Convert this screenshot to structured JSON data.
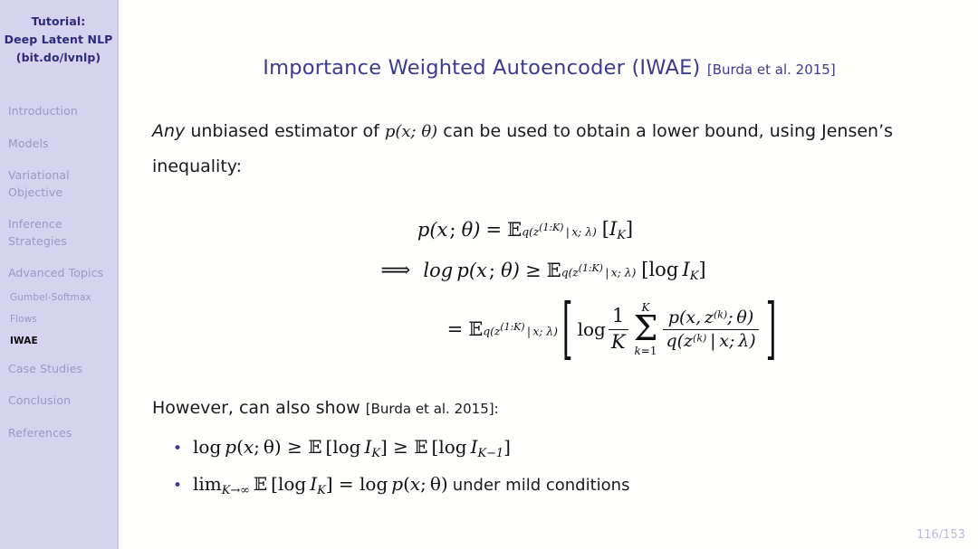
{
  "sidebar": {
    "title_lines": [
      "Tutorial:",
      "Deep Latent NLP",
      "(bit.do/lvnlp)"
    ],
    "items": [
      {
        "label": "Introduction",
        "level": 1,
        "active": false
      },
      {
        "label": "Models",
        "level": 1,
        "active": false
      },
      {
        "label": "Variational",
        "label2": "Objective",
        "level": 1,
        "active": false
      },
      {
        "label": "Inference",
        "label2": "Strategies",
        "level": 1,
        "active": false
      },
      {
        "label": "Advanced Topics",
        "level": 1,
        "active": false
      },
      {
        "label": "Gumbel-Softmax",
        "level": 2,
        "active": false
      },
      {
        "label": "Flows",
        "level": 2,
        "active": false
      },
      {
        "label": "IWAE",
        "level": 2,
        "active": true
      },
      {
        "label": "Case Studies",
        "level": 1,
        "active": false
      },
      {
        "label": "Conclusion",
        "level": 1,
        "active": false
      },
      {
        "label": "References",
        "level": 1,
        "active": false
      }
    ],
    "colors": {
      "background": "#d6d3f0",
      "title_text": "#2c2a7a",
      "item_text": "#9a98c4",
      "active_text": "#0b0b0b"
    }
  },
  "header": {
    "title": "Importance Weighted Autoencoder (IWAE)",
    "citation": "[Burda et al. 2015]",
    "color": "#3b3a8c"
  },
  "intro": {
    "emphasis": "Any",
    "part1": " unbiased estimator of ",
    "math": "p(x; θ)",
    "part2": " can be used to obtain a lower bound, using Jensen’s inequality:"
  },
  "equations": {
    "row1": {
      "lhs": "p(x; θ)",
      "relation": "=",
      "operator": "𝔼",
      "operator_subscript": "q(z^(1:K) | x; λ)",
      "argument": "[I_K]"
    },
    "row2": {
      "implies": "⟹",
      "lhs": "log p(x; θ)",
      "relation": "≥",
      "operator": "𝔼",
      "operator_subscript": "q(z^(1:K) | x; λ)",
      "argument": "[log I_K]"
    },
    "row3": {
      "relation": "=",
      "operator": "𝔼",
      "operator_subscript": "q(z^(1:K) | x; λ)",
      "log": "log",
      "coefficient_num": "1",
      "coefficient_den": "K",
      "sum_upper": "K",
      "sum_lower": "k=1",
      "fraction_num": "p(x, z^(k); θ)",
      "fraction_den": "q(z^(k) | x; λ)"
    }
  },
  "however": {
    "text": "However, can also show",
    "citation": "[Burda et al. 2015]:"
  },
  "bullets": [
    {
      "marker": "•",
      "math": "log p(x; θ) ≥ 𝔼 [log I_K] ≥ 𝔼 [log I_{K−1}]",
      "trailing_text": ""
    },
    {
      "marker": "•",
      "math": "lim_{K→∞} 𝔼 [log I_K] = log p(x; θ)",
      "trailing_text": "under mild conditions"
    }
  ],
  "footer": {
    "page": "116/153",
    "color": "#bcbada"
  }
}
